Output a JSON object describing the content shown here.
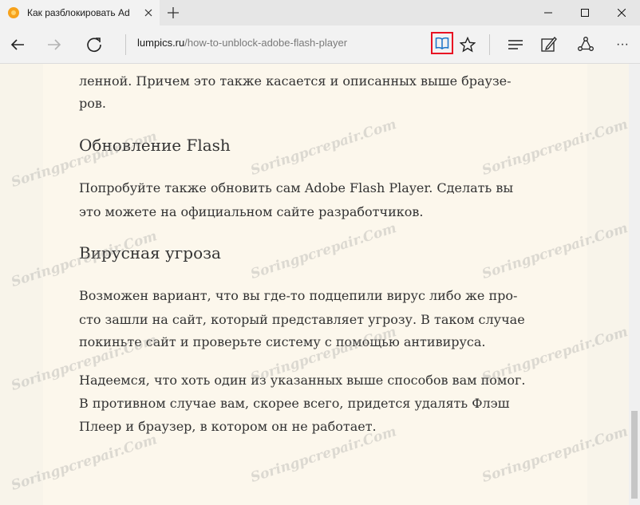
{
  "browser": {
    "tab_title": "Как разблокировать Ad",
    "address_domain": "lumpics.ru",
    "address_path": "/how-to-unblock-adobe-flash-player",
    "new_tab_symbol": "+",
    "more_symbol": "···"
  },
  "icons": {
    "favicon": "orange-flower-icon",
    "back": "back-arrow-icon",
    "forward": "forward-arrow-icon",
    "refresh": "refresh-icon",
    "reading_view": "book-icon",
    "favorite": "star-icon",
    "hub": "hub-lines-icon",
    "notes": "pen-note-icon",
    "share": "share-icon"
  },
  "colors": {
    "highlight_border": "#e81123",
    "reading_icon": "#1a73c8",
    "page_bg": "#fcf7ec"
  },
  "article": {
    "partial_top": "ленной. Причем это также касается и описанных выше браузе-",
    "partial_top2": "ров.",
    "h1": "Обновление Flash",
    "p1_l1": "Попробуйте также обновить сам Adobe Flash Player. Сделать вы",
    "p1_l2": "это можете на официальном сайте разработчиков.",
    "h2": "Вирусная угроза",
    "p2_l1": "Возможен вариант, что вы где-то подцепили вирус либо же про-",
    "p2_l2": "сто зашли на сайт, который представляет угрозу. В таком случае",
    "p2_l3": "покиньте сайт и проверьте систему с помощью антивируса.",
    "p3_l1": "Надеемся, что хоть один из указанных выше способов вам помог.",
    "p3_l2": "В противном случае вам, скорее всего, придется удалять Флэш",
    "p3_l3": "Плеер и браузер, в котором он не работает."
  },
  "watermark": "Soringpcrepair.Com"
}
